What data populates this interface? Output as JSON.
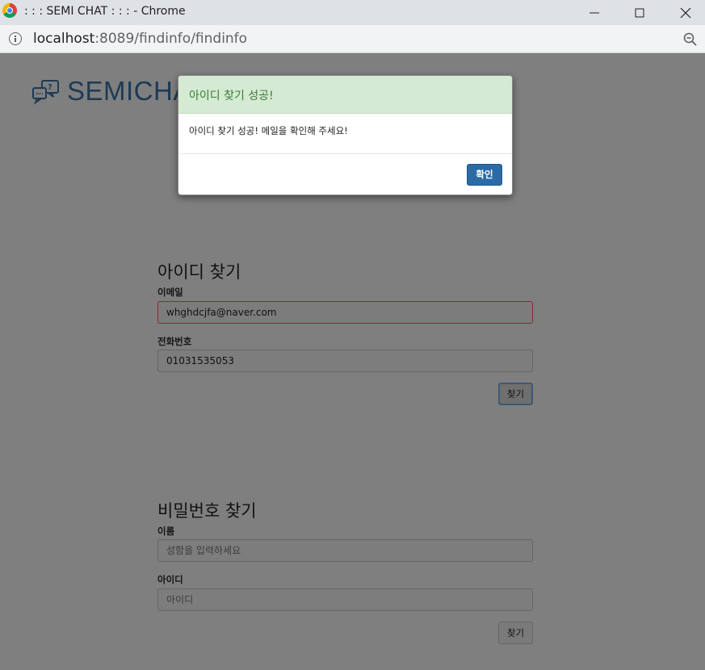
{
  "window": {
    "title": ": : : SEMI CHAT : : : - Chrome",
    "url_host": "localhost",
    "url_rest": ":8089/findinfo/findinfo"
  },
  "icons": {
    "chrome": "chrome-logo-icon",
    "minimize": "minimize-icon",
    "maximize": "maximize-icon",
    "close": "close-icon",
    "info": "info-icon",
    "zoom": "zoom-out-icon",
    "brand": "chat-bubbles-icon"
  },
  "brand": {
    "text": "SEMICHA"
  },
  "find_id": {
    "title": "아이디 찾기",
    "email_label": "이메일",
    "email_value": "whghdcjfa@naver.com",
    "phone_label": "전화번호",
    "phone_value": "01031535053",
    "button": "찾기"
  },
  "find_pw": {
    "title": "비밀번호 찾기",
    "name_label": "이름",
    "name_placeholder": "성함을 입력하세요",
    "id_label": "아이디",
    "id_placeholder": "아이디",
    "button": "찾기"
  },
  "modal": {
    "title": "아이디 찾기 성공!",
    "message": "아이디 찾기 성공! 메일을 확인해 주세요!",
    "ok_button": "확인"
  },
  "colors": {
    "modal_header_bg": "#d4ead2",
    "modal_title": "#3c7a3a",
    "ok_button": "#2c6aa6",
    "brand": "#1d3a55",
    "backdrop": "#7f7f7f"
  }
}
